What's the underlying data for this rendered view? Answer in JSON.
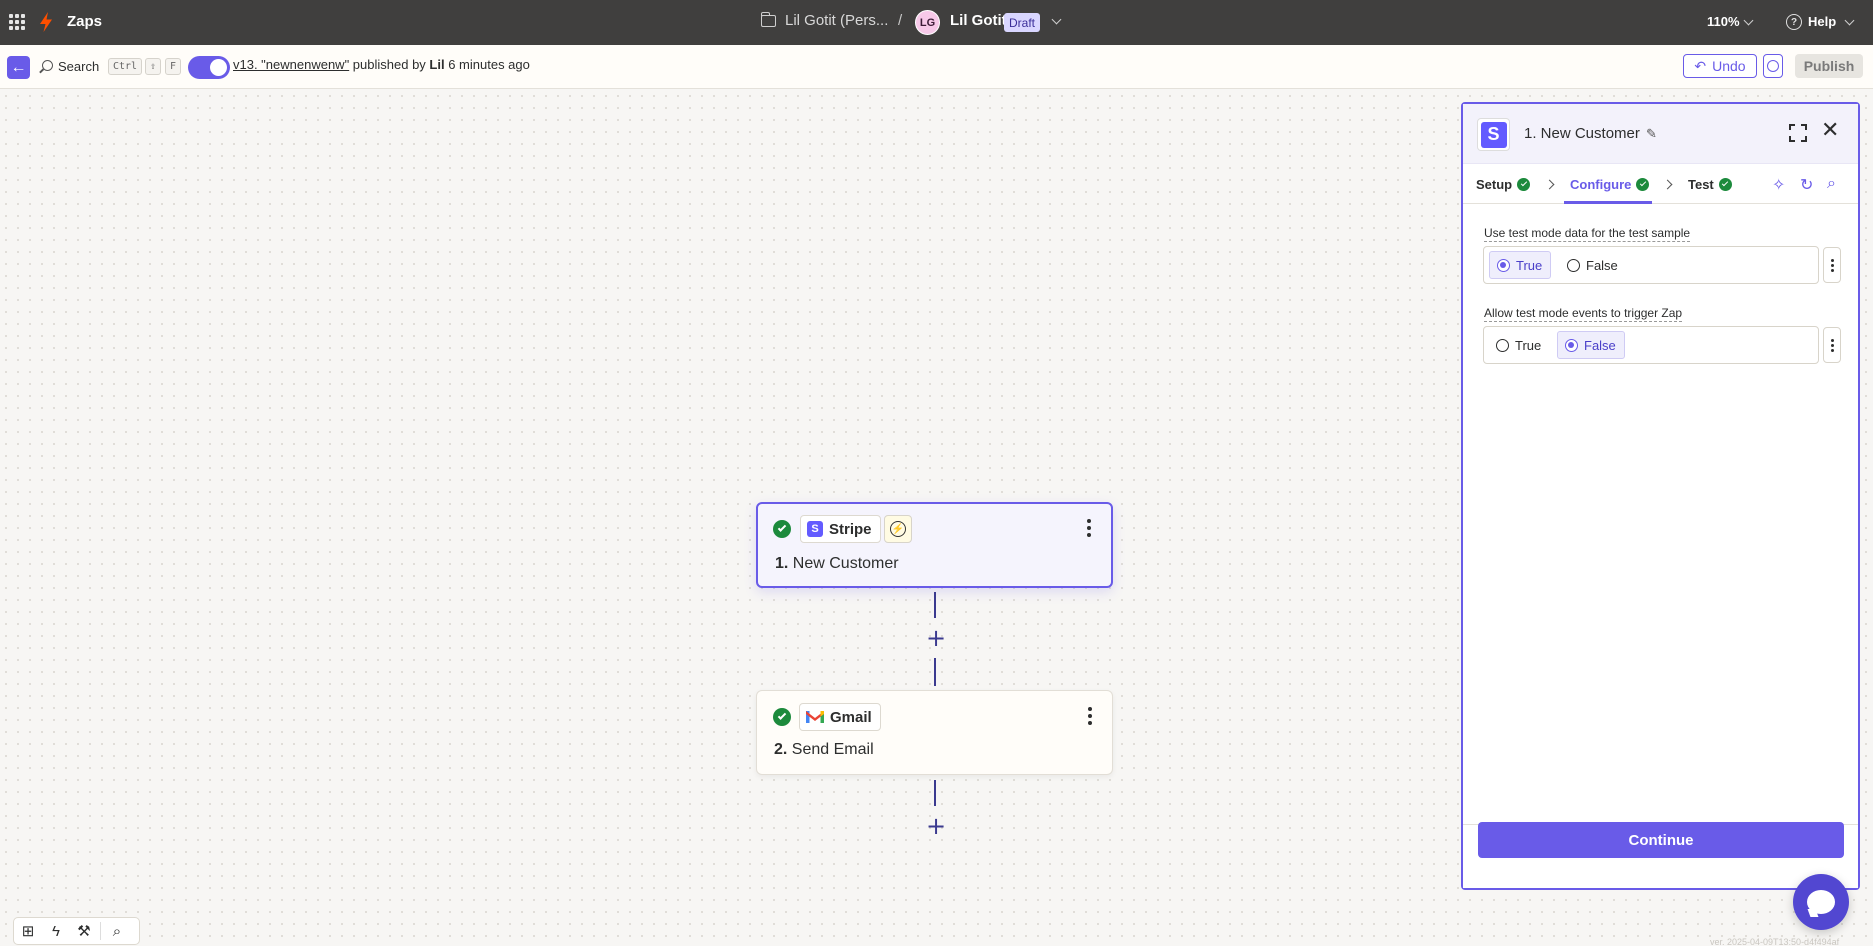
{
  "topbar": {
    "app_title": "Zaps",
    "folder": "Lil Gotit (Pers...",
    "separator": "/",
    "user_initials": "LG",
    "user_name": "Lil Gotit",
    "status_badge": "Draft",
    "zoom": "110%",
    "help": "Help"
  },
  "subbar": {
    "search_label": "Search",
    "shortcut_keys": [
      "Ctrl",
      "⇧",
      "F"
    ],
    "version_link": "v13. \"newnenwenw\"",
    "published_by_prefix": " published by ",
    "publisher": "Lil",
    "published_time": " 6 minutes ago",
    "undo_label": "Undo",
    "publish_label": "Publish"
  },
  "steps": [
    {
      "app": "Stripe",
      "number": "1.",
      "title": "New Customer",
      "status": "complete",
      "selected": true
    },
    {
      "app": "Gmail",
      "number": "2.",
      "title": "Send Email",
      "status": "complete",
      "selected": false
    }
  ],
  "panel": {
    "title": "1. New Customer",
    "tabs": [
      {
        "label": "Setup",
        "complete": true
      },
      {
        "label": "Configure",
        "complete": true,
        "active": true
      },
      {
        "label": "Test",
        "complete": true
      }
    ],
    "fields": [
      {
        "label": "Use test mode data for the test sample",
        "options": [
          "True",
          "False"
        ],
        "selected": "True"
      },
      {
        "label": "Allow test mode events to trigger Zap",
        "options": [
          "True",
          "False"
        ],
        "selected": "False"
      }
    ],
    "continue_label": "Continue"
  },
  "footer_version": "ver. 2025-04-09T13:50-d4f494af",
  "colors": {
    "accent": "#695be8",
    "topbar": "#403f3e",
    "success": "#1c8a3c",
    "brand_orange": "#ff4f00"
  }
}
